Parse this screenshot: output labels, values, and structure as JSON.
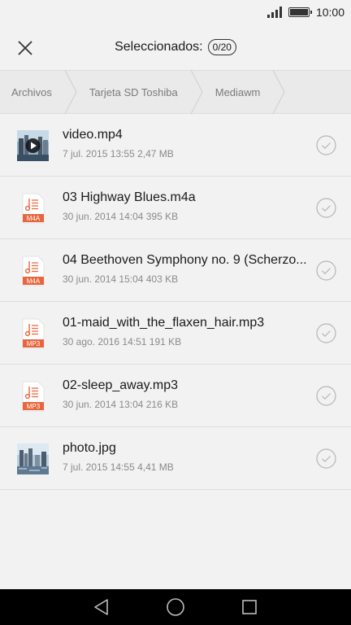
{
  "status_bar": {
    "time": "10:00",
    "icons": [
      "signal-icon",
      "battery-icon"
    ]
  },
  "header": {
    "title": "Seleccionados:",
    "count": "0/20",
    "close_icon": "close-icon"
  },
  "breadcrumb": [
    {
      "label": "Archivos"
    },
    {
      "label": "Tarjeta SD Toshiba"
    },
    {
      "label": "Mediawm"
    }
  ],
  "files": [
    {
      "name": "video.mp4",
      "meta": "7 jul. 2015 13:55 2,47 MB",
      "type": "video",
      "badge": ""
    },
    {
      "name": "03 Highway Blues.m4a",
      "meta": "30 jun. 2014 14:04 395 KB",
      "type": "audio",
      "badge": "M4A"
    },
    {
      "name": "04 Beethoven Symphony no. 9 (Scherzo...",
      "meta": "30 jun. 2014 15:04 403 KB",
      "type": "audio",
      "badge": "M4A"
    },
    {
      "name": "01-maid_with_the_flaxen_hair.mp3",
      "meta": "30 ago. 2016 14:51 191 KB",
      "type": "audio",
      "badge": "MP3"
    },
    {
      "name": "02-sleep_away.mp3",
      "meta": "30 jun. 2014 13:04 216 KB",
      "type": "audio",
      "badge": "MP3"
    },
    {
      "name": "photo.jpg",
      "meta": "7 jul. 2015 14:55 4,41 MB",
      "type": "image",
      "badge": ""
    }
  ],
  "colors": {
    "audio_accent": "#e8663d",
    "check_stroke": "#b5b5b5",
    "background": "#f2f2f2",
    "nav_bar": "#000000"
  },
  "nav_bar": {
    "buttons": [
      "back-icon",
      "home-icon",
      "recents-icon"
    ]
  }
}
